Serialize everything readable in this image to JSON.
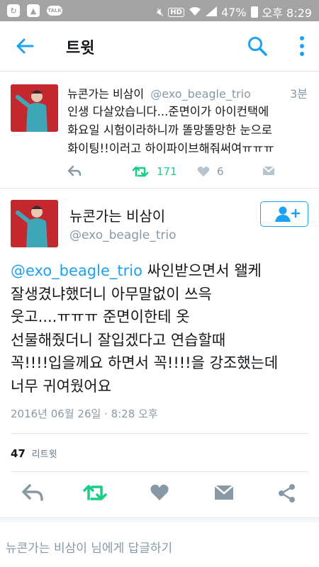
{
  "status_bar": {
    "battery": "47%",
    "time": "오후 8:29",
    "hd_label": "HD",
    "talk_label": "TALK"
  },
  "app_bar": {
    "title": "트윗"
  },
  "prev_tweet": {
    "name": "뉴콘가는 비삼이",
    "handle": "@exo_beagle_trio",
    "time": "3분",
    "text_lines": [
      "인생 다살았습니다...준면이가 아이컨택에",
      "화요일 시험이라하니까 똘망똘망한 눈으로",
      "화이팅!!이러고 하이파이브해줘써여ㅠㅠㅠ"
    ],
    "retweets": "171",
    "likes": "6"
  },
  "main_tweet": {
    "name": "뉴콘가는 비삼이",
    "handle": "@exo_beagle_trio",
    "mention": "@exo_beagle_trio",
    "text_first": " 싸인받으면서 왤케",
    "text_lines": [
      "잘생겼냐했더니 아무말없이 쓰윽",
      "웃고....ㅠㅠㅠ 준면이한테 옷",
      "선물해줬더니 잘입겠다고 연습할때",
      "꼭!!!!입을께요 하면서 꼭!!!!을 강조했는데",
      "너무 귀여웠어요"
    ],
    "date": "2016년 06월 26일 · 8:28 오후",
    "retweet_count": "47",
    "retweet_label": "리트윗"
  },
  "reply_box": {
    "placeholder": "뉴콘가는 비삼이 님에게 답글하기"
  },
  "colors": {
    "accent": "#1da1f2",
    "retweet_green": "#19cf86",
    "muted": "#8899a6",
    "avatar_bg": "#c4282f"
  }
}
